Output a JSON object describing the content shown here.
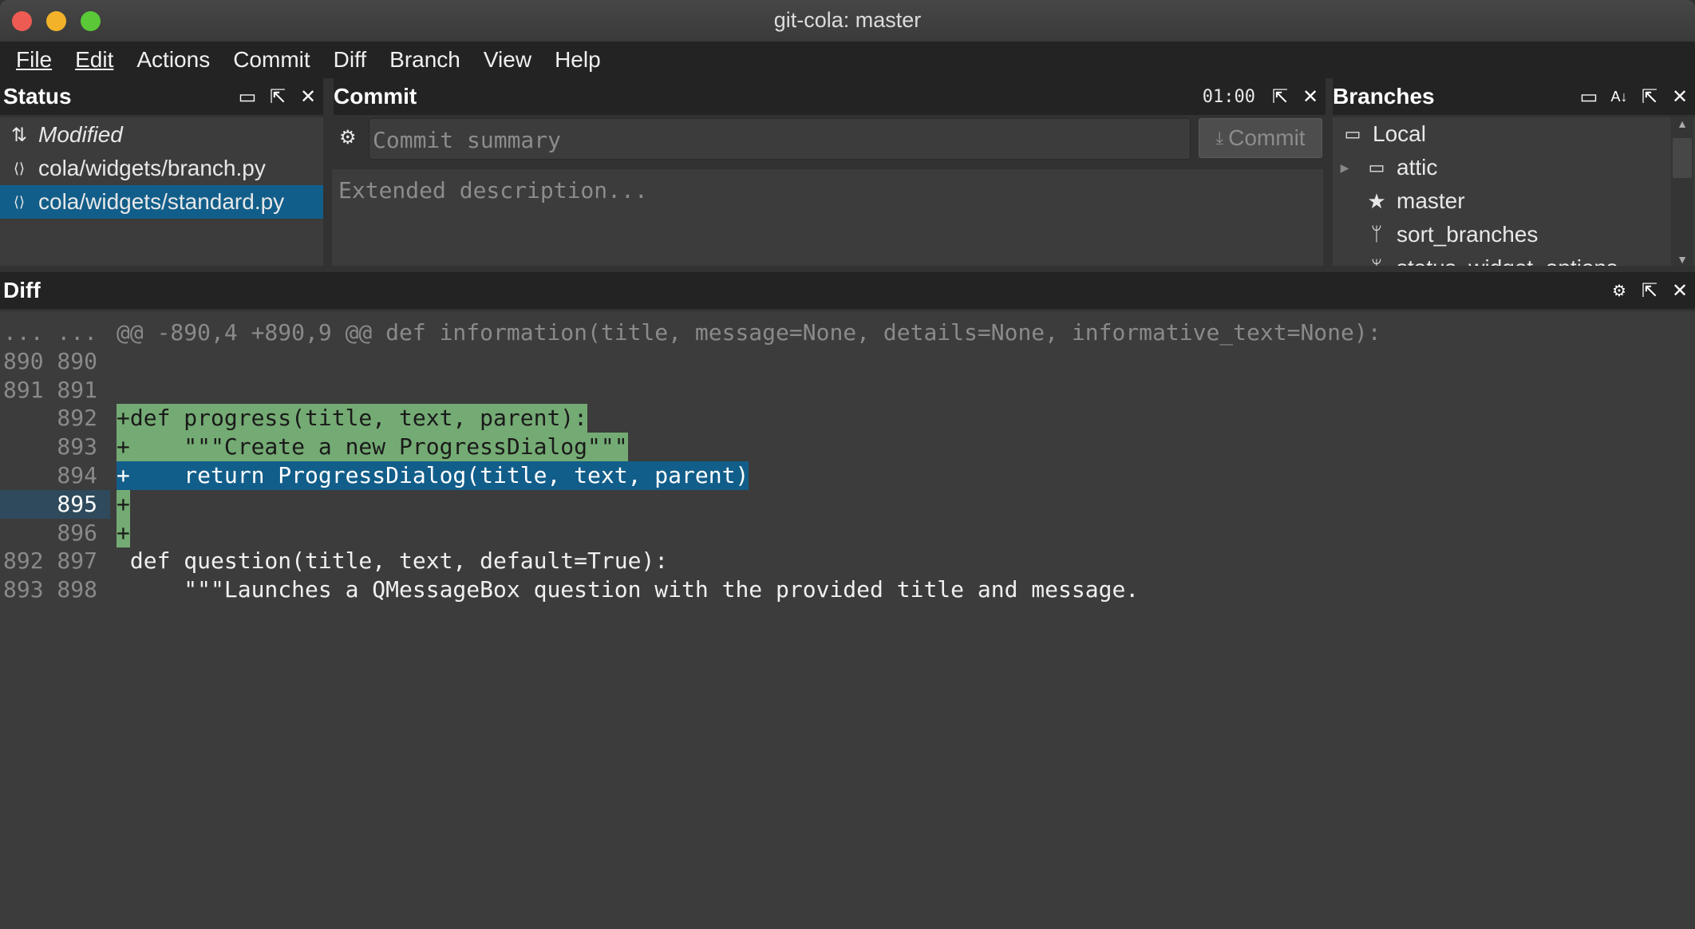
{
  "window": {
    "title": "git-cola: master",
    "traffic_colors": [
      "#ed5b53",
      "#f2b32a",
      "#5ac837"
    ]
  },
  "menu": [
    "File",
    "Edit",
    "Actions",
    "Commit",
    "Diff",
    "Branch",
    "View",
    "Help"
  ],
  "status": {
    "title": "Status",
    "items": [
      {
        "label": "Modified",
        "icon": "modified-icon"
      },
      {
        "label": "cola/widgets/branch.py",
        "icon": "source-file-icon"
      },
      {
        "label": "cola/widgets/standard.py",
        "icon": "source-file-icon",
        "selected": true
      }
    ]
  },
  "commit": {
    "title": "Commit",
    "timer": "01:00",
    "summary_placeholder": "Commit summary",
    "description_placeholder": "Extended description...",
    "button": "Commit"
  },
  "branches": {
    "title": "Branches",
    "items": [
      {
        "label": "Local",
        "icon": "branch-group-icon"
      },
      {
        "label": "attic",
        "icon": "branch-group-icon",
        "expandable": true
      },
      {
        "label": "master",
        "icon": "star-icon"
      },
      {
        "label": "sort_branches",
        "icon": "branch-icon"
      },
      {
        "label": "status_widget_options",
        "icon": "branch-icon"
      }
    ]
  },
  "diff": {
    "title": "Diff",
    "lines": [
      {
        "old": "...",
        "new": "...",
        "text": "@@ -890,4 +890,9 @@ def information(title, message=None, details=None, informative_text=None):",
        "type": "hunk"
      },
      {
        "old": "890",
        "new": "890",
        "text": "",
        "type": "ctx"
      },
      {
        "old": "891",
        "new": "891",
        "text": "",
        "type": "ctx"
      },
      {
        "old": "",
        "new": "892",
        "text": "+def progress(title, text, parent):",
        "type": "add"
      },
      {
        "old": "",
        "new": "893",
        "text": "+    \"\"\"Create a new ProgressDialog\"\"\"",
        "type": "add"
      },
      {
        "old": "",
        "new": "894",
        "text": "+    return ProgressDialog(title, text, parent)",
        "type": "sel"
      },
      {
        "old": "",
        "new": "895",
        "text": "+",
        "type": "add",
        "current": true
      },
      {
        "old": "",
        "new": "896",
        "text": "+",
        "type": "add"
      },
      {
        "old": "892",
        "new": "897",
        "text": " def question(title, text, default=True):",
        "type": "ctx"
      },
      {
        "old": "893",
        "new": "898",
        "text": "     \"\"\"Launches a QMessageBox question with the provided title and message.",
        "type": "ctx"
      }
    ]
  }
}
